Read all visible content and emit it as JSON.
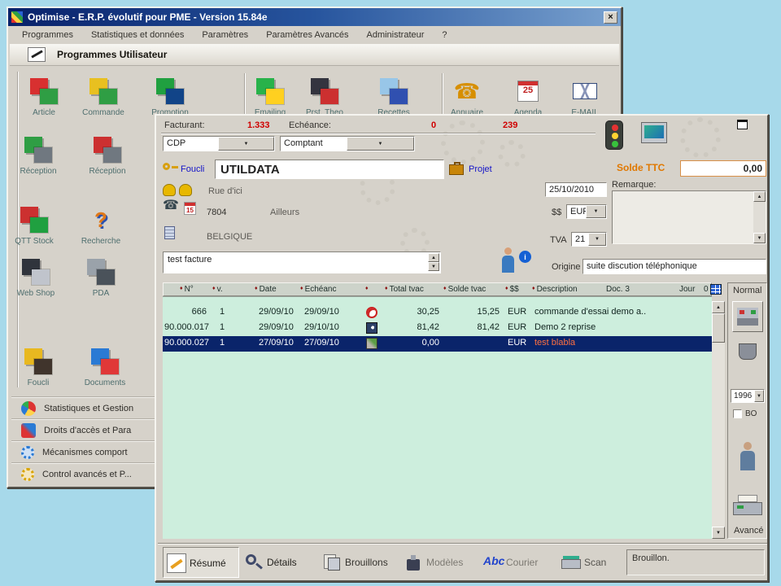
{
  "icons": {
    "diamond": "♦",
    "arrow_up": "▲",
    "arrow_down": "▼",
    "phone": "☎",
    "info": "i",
    "question": "?",
    "close": "×"
  },
  "main_window": {
    "title": "Optimise  -  E.R.P. évolutif pour PME   -  Version 15.84e",
    "menu": [
      "Programmes",
      "Statistiques et données",
      "Paramètres",
      "Paramètres Avancés",
      "Administrateur",
      "?"
    ],
    "banner": "Programmes Utilisateur",
    "agenda_day": "25",
    "icons": [
      {
        "label": "Article"
      },
      {
        "label": "Commande"
      },
      {
        "label": "Promotion"
      },
      {
        "label": "Emailing"
      },
      {
        "label": "Prst. Theo"
      },
      {
        "label": "Recettes"
      },
      {
        "label": "Annuaire"
      },
      {
        "label": "Agenda"
      },
      {
        "label": "E-MAIL"
      },
      {
        "label": "Réception"
      },
      {
        "label": "Réception"
      },
      {
        "label": "QTT Stock"
      },
      {
        "label": "Recherche"
      },
      {
        "label": "Web Shop"
      },
      {
        "label": "PDA"
      },
      {
        "label": "Foucli"
      },
      {
        "label": "Documents"
      }
    ],
    "bottom_items": [
      "Statistiques et Gestion",
      "Droits d'accès et Para",
      "Mécanismes comport",
      "Control avancés et P..."
    ]
  },
  "invoice": {
    "facturant_label": "Facturant:",
    "facturant_value": "1.333",
    "echeance_label": "Echéance:",
    "echeance_value": "0",
    "counter_value": "239",
    "client_combo": "CDP",
    "payment_combo": "Comptant",
    "foucli_label": "Foucli",
    "client_name": "UTILDATA",
    "projet_label": "Projet",
    "solde_ttc_label": "Solde TTC",
    "solde_ttc_value": "0,00",
    "street": "Rue d'ici",
    "invoice_date": "25/10/2010",
    "remarque_label": "Remarque:",
    "calendar_day": "15",
    "postal_code": "7804",
    "city": "Ailleurs",
    "currency_label": "$$",
    "currency": "EUR",
    "country": "BELGIQUE",
    "tva_label": "TVA",
    "tva_rate": "21",
    "subject": "test facture",
    "origin_label": "Origine",
    "origin_value": "suite discution téléphonique",
    "grid": {
      "headers": {
        "num": "N°",
        "version": "v.",
        "date": "Date",
        "echeance": "Echéanc",
        "total": "Total tvac",
        "solde": "Solde tvac",
        "currency": "$$",
        "description": "Description",
        "doc": "Doc. 3",
        "jour": "Jour",
        "zero": "0"
      },
      "rows": [
        {
          "num": "666",
          "v": "1",
          "date": "29/09/10",
          "echeance": "29/09/10",
          "total": "30,25",
          "solde": "15,25",
          "cur": "EUR",
          "desc": "commande d'essai demo a.."
        },
        {
          "num": "90.000.017",
          "v": "1",
          "date": "29/09/10",
          "echeance": "29/10/10",
          "total": "81,42",
          "solde": "81,42",
          "cur": "EUR",
          "desc": "Demo 2 reprise"
        },
        {
          "num": "90.000.027",
          "v": "1",
          "date": "27/09/10",
          "echeance": "27/09/10",
          "total": "0,00",
          "solde": "",
          "cur": "EUR",
          "desc": "test blabla"
        }
      ]
    },
    "side_panel": {
      "mode": "Normal",
      "year": "1996",
      "bo_label": "BO",
      "advanced_label": "Avancé"
    },
    "tabs": [
      {
        "label": "Résumé"
      },
      {
        "label": "Détails"
      },
      {
        "label": "Brouillons"
      },
      {
        "label": "Modèles"
      },
      {
        "label": "Courier"
      },
      {
        "label": "Scan"
      }
    ],
    "courier_glyph": "Abc",
    "status": "Brouillon."
  }
}
